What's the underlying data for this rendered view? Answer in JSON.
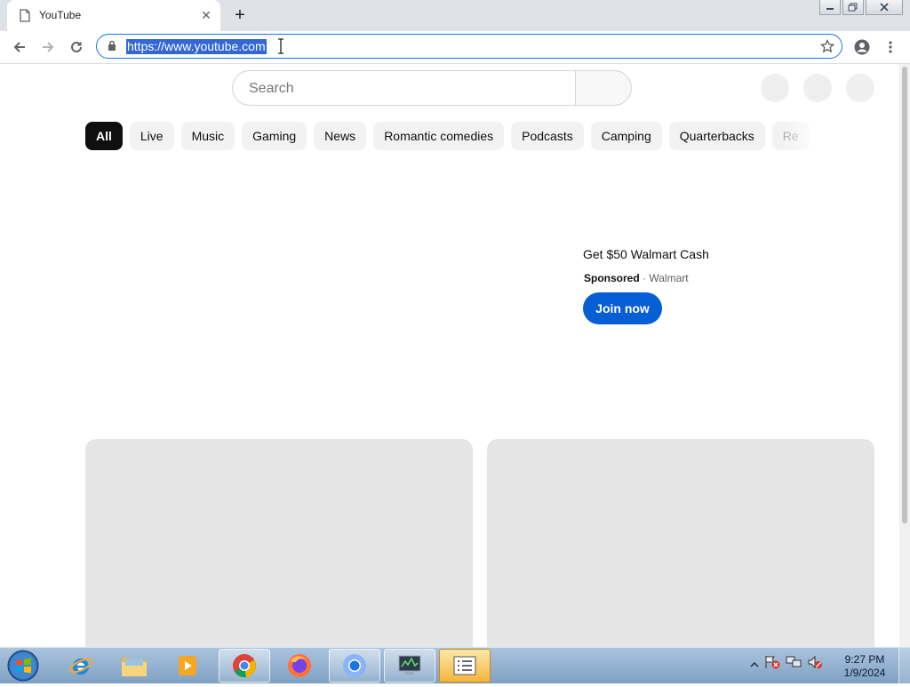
{
  "browser": {
    "tab": {
      "title": "YouTube"
    },
    "url": "https://www.youtube.com"
  },
  "youtube": {
    "search": {
      "placeholder": "Search"
    },
    "chips": [
      "All",
      "Live",
      "Music",
      "Gaming",
      "News",
      "Romantic comedies",
      "Podcasts",
      "Camping",
      "Quarterbacks",
      "Re"
    ],
    "ad": {
      "title": "Get $50 Walmart Cash",
      "sponsored": "Sponsored",
      "separator": "·",
      "advertiser": "Walmart",
      "cta": "Join now"
    }
  },
  "taskbar": {
    "apps": [
      "internet-explorer",
      "windows-explorer",
      "media-player",
      "google-chrome",
      "firefox",
      "chromium",
      "task-manager",
      "notepad-list"
    ],
    "clock": {
      "time": "9:27 PM",
      "date": "1/9/2024"
    }
  },
  "colors": {
    "accent": "#065fd4",
    "url_highlight": "#3367d6",
    "chip_active": "#0f0f0f",
    "chip_bg": "#f2f2f2"
  }
}
